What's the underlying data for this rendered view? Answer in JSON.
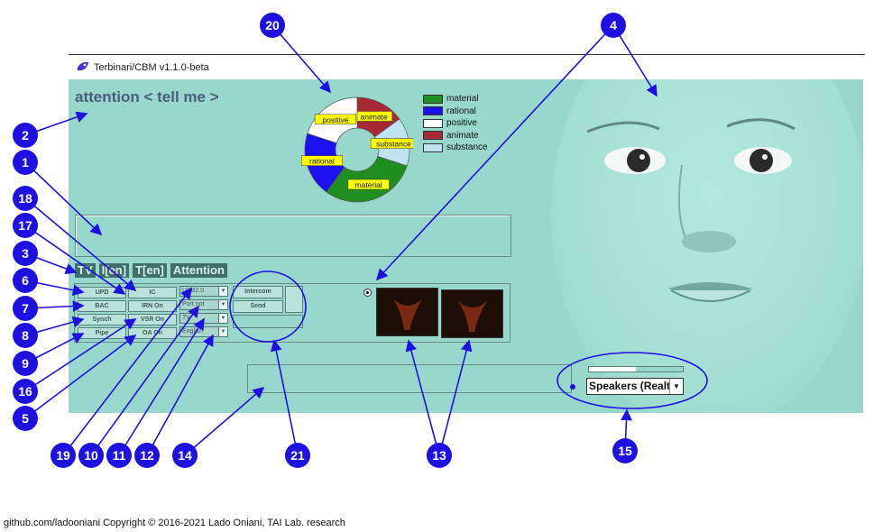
{
  "window": {
    "title": "Terbinari/CBM v1.1.0-beta"
  },
  "main": {
    "attention_label": "attention < tell me >"
  },
  "legend": [
    {
      "label": "material",
      "color": "#1f8f1f"
    },
    {
      "label": "rational",
      "color": "#1a10f0"
    },
    {
      "label": "positive",
      "color": "#ffffff"
    },
    {
      "label": "animate",
      "color": "#a52a35"
    },
    {
      "label": "substance",
      "color": "#bfe3ef"
    }
  ],
  "chart_data": {
    "type": "pie",
    "categories": [
      "material",
      "rational",
      "positive",
      "animate",
      "substance"
    ],
    "values": [
      30,
      20,
      20,
      15,
      15
    ],
    "colors": [
      "#1f8f1f",
      "#1a10f0",
      "#ffffff",
      "#a52a35",
      "#bfe3ef"
    ],
    "slice_labels": [
      "material",
      "rational",
      "positive",
      "animate",
      "substance"
    ]
  },
  "tabs": [
    "TV",
    "I[en]",
    "T[en]",
    "Attention"
  ],
  "buttons": {
    "upd": "UPD",
    "bac": "BAC",
    "synch": "Synch",
    "pipe": "Pipe",
    "ic": "IC",
    "irn": "IRN On",
    "vsr": "VSR On",
    "oa": "OA On",
    "intercom": "Intercom",
    "send": "Send"
  },
  "combos": {
    "usb": "USB2.0",
    "port": "Port not",
    "tv": "TV",
    "lang": "English"
  },
  "audio": {
    "device": "Speakers (Realt",
    "volume_level": 0.5
  },
  "callouts": [
    "20",
    "4",
    "2",
    "1",
    "18",
    "17",
    "3",
    "6",
    "7",
    "8",
    "9",
    "16",
    "5",
    "19",
    "10",
    "11",
    "12",
    "14",
    "21",
    "13",
    "15"
  ],
  "footer": "github.com/ladooniani Copyright © 2016-2021 Lado Oniani, TAI Lab. research"
}
